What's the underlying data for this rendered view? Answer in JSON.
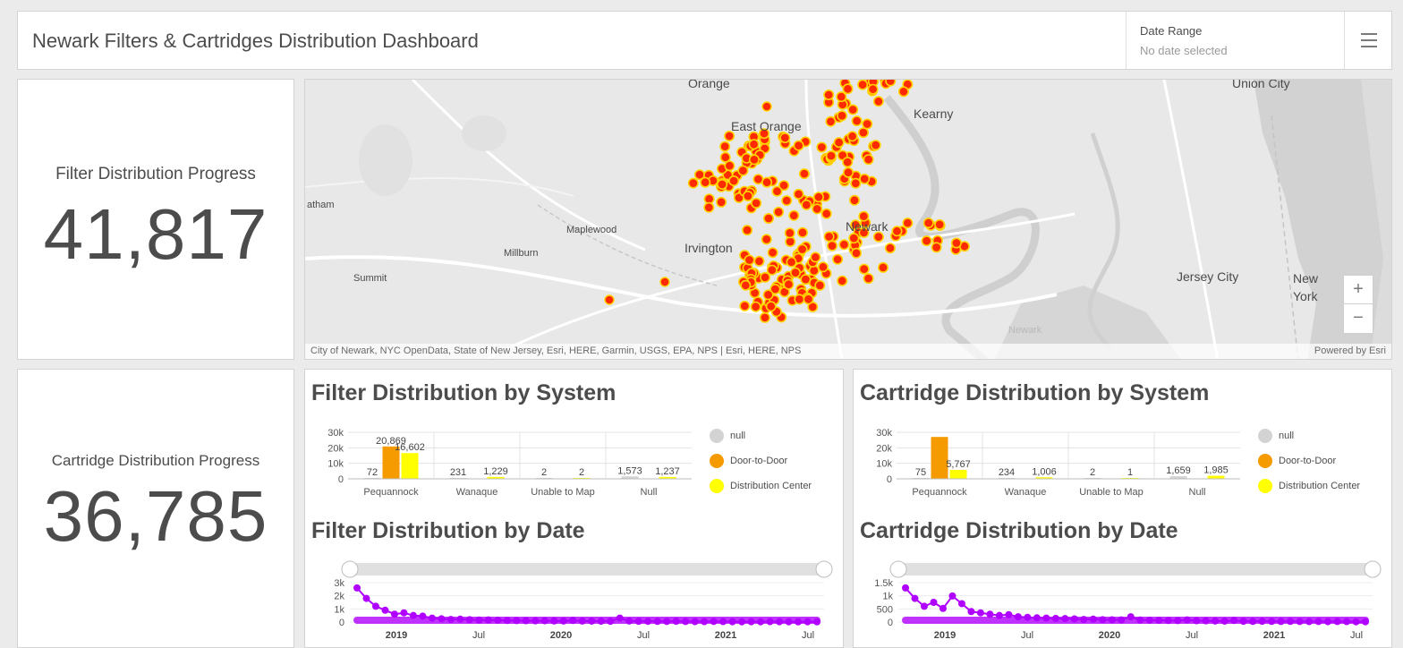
{
  "header": {
    "title": "Newark Filters & Cartridges Distribution Dashboard",
    "date_label": "Date Range",
    "date_value": "No date selected"
  },
  "indicators": [
    {
      "title": "Filter Distribution Progress",
      "value": "41,817"
    },
    {
      "title": "Cartridge Distribution Progress",
      "value": "36,785"
    }
  ],
  "map": {
    "labels": [
      "Orange",
      "East Orange",
      "Kearny",
      "Union City",
      "atham",
      "Maplewood",
      "Irvington",
      "Newark",
      "Millburn",
      "Summit",
      "Jersey City",
      "New",
      "York",
      "Newark"
    ],
    "attribution": "City of Newark, NYC OpenData, State of New Jersey, Esri, HERE, Garmin, USGS, EPA, NPS | Esri, HERE, NPS",
    "powered_by": "Powered by Esri",
    "zoom_in": "+",
    "zoom_out": "−",
    "point_color": "#ff2a00",
    "point_outline": "#ffd400"
  },
  "legend": [
    {
      "label": "null",
      "color": "#d3d3d3"
    },
    {
      "label": "Door-to-Door",
      "color": "#f59b00"
    },
    {
      "label": "Distribution Center",
      "color": "#ffff00"
    }
  ],
  "chart_data": [
    {
      "type": "bar",
      "title": "Filter Distribution by System",
      "categories": [
        "Pequannock",
        "Wanaque",
        "Unable to Map",
        "Null"
      ],
      "series": [
        {
          "name": "null",
          "color": "#d3d3d3",
          "values": [
            72,
            231,
            2,
            1573
          ]
        },
        {
          "name": "Door-to-Door",
          "color": "#f59b00",
          "values": [
            20869,
            0,
            0,
            0
          ]
        },
        {
          "name": "Distribution Center",
          "color": "#ffff00",
          "values": [
            16602,
            1229,
            2,
            1237
          ]
        }
      ],
      "data_labels": [
        [
          "72",
          "20,869",
          "16,602"
        ],
        [
          "231",
          "",
          "1,229"
        ],
        [
          "2",
          "",
          "2"
        ],
        [
          "1,573",
          "",
          "1,237"
        ]
      ],
      "yticks": [
        "30k",
        "20k",
        "10k",
        "0"
      ],
      "ylim": [
        0,
        30000
      ]
    },
    {
      "type": "bar",
      "title": "Cartridge Distribution by System",
      "categories": [
        "Pequannock",
        "Wanaque",
        "Unable to Map",
        "Null"
      ],
      "series": [
        {
          "name": "null",
          "color": "#d3d3d3",
          "values": [
            75,
            234,
            2,
            1659
          ]
        },
        {
          "name": "Door-to-Door",
          "color": "#f59b00",
          "values": [
            27000,
            0,
            0,
            0
          ]
        },
        {
          "name": "Distribution Center",
          "color": "#ffff00",
          "values": [
            5767,
            1006,
            1,
            1985
          ]
        }
      ],
      "data_labels": [
        [
          "75",
          "",
          "5,767"
        ],
        [
          "234",
          "",
          "1,006"
        ],
        [
          "2",
          "",
          "1"
        ],
        [
          "1,659",
          "",
          "1,985"
        ]
      ],
      "yticks": [
        "30k",
        "20k",
        "10k",
        "0"
      ],
      "ylim": [
        0,
        30000
      ]
    },
    {
      "type": "line",
      "title": "Filter Distribution by Date",
      "color": "#b000ff",
      "yticks": [
        "3k",
        "2k",
        "1k",
        "0"
      ],
      "xticks": [
        "2019",
        "Jul",
        "2020",
        "Jul",
        "2021",
        "Jul"
      ],
      "ylim": [
        0,
        3000
      ],
      "values": [
        2600,
        1800,
        1200,
        900,
        600,
        700,
        500,
        450,
        300,
        250,
        200,
        220,
        180,
        150,
        160,
        140,
        120,
        110,
        100,
        90,
        95,
        85,
        80,
        120,
        75,
        70,
        65,
        60,
        300,
        80,
        60,
        55,
        50,
        45,
        60,
        40,
        35,
        30,
        45,
        30,
        25,
        20,
        25,
        20,
        30,
        25,
        20,
        15,
        20,
        15
      ]
    },
    {
      "type": "line",
      "title": "Cartridge Distribution by Date",
      "color": "#b000ff",
      "yticks": [
        "1.5k",
        "1k",
        "500",
        "0"
      ],
      "xticks": [
        "2019",
        "Jul",
        "2020",
        "Jul",
        "2021",
        "Jul"
      ],
      "ylim": [
        0,
        1500
      ],
      "values": [
        1300,
        900,
        600,
        750,
        520,
        993,
        700,
        400,
        350,
        300,
        250,
        280,
        200,
        180,
        160,
        150,
        140,
        130,
        120,
        100,
        110,
        90,
        85,
        80,
        200,
        75,
        70,
        65,
        60,
        55,
        80,
        50,
        45,
        40,
        35,
        60,
        30,
        25,
        30,
        25,
        20,
        25,
        20,
        15,
        20,
        15,
        20,
        15,
        10,
        10
      ]
    }
  ]
}
